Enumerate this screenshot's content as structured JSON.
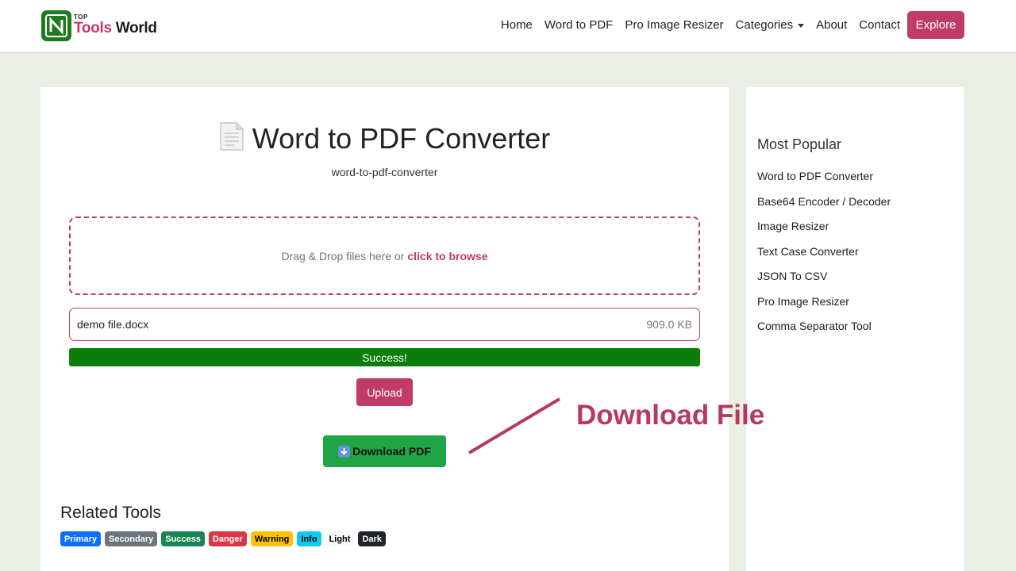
{
  "nav": {
    "logo": {
      "top_word": "TOP",
      "name_part1": "Tools",
      "name_part2": " World"
    },
    "links": [
      "Home",
      "Word to PDF",
      "Pro Image Resizer",
      "Categories",
      "About",
      "Contact"
    ],
    "explore_label": "Explore"
  },
  "main": {
    "title": "Word to PDF Converter",
    "title_icon": "document-icon",
    "subtitle": "word-to-pdf-converter",
    "dropzone": {
      "text": "Drag & Drop files here or",
      "browse": "click to browse"
    },
    "file": {
      "name": "demo file.docx",
      "size": "909.0 KB"
    },
    "progress": {
      "percent": 100,
      "label": "Success!"
    },
    "upload_label": "Upload",
    "download_label": "Download PDF",
    "download_icon": "down-arrow-icon",
    "related_title": "Related Tools",
    "badges": [
      {
        "label": "Primary",
        "bg": "#0d6efd",
        "fg": "#ffffff"
      },
      {
        "label": "Secondary",
        "bg": "#6c757d",
        "fg": "#ffffff"
      },
      {
        "label": "Success",
        "bg": "#198754",
        "fg": "#ffffff"
      },
      {
        "label": "Danger",
        "bg": "#dc3545",
        "fg": "#ffffff"
      },
      {
        "label": "Warning",
        "bg": "#ffc107",
        "fg": "#000000"
      },
      {
        "label": "Info",
        "bg": "#0dcaf0",
        "fg": "#000000"
      },
      {
        "label": "Light",
        "bg": "#f8f9fa",
        "fg": "#000000"
      },
      {
        "label": "Dark",
        "bg": "#212529",
        "fg": "#ffffff"
      }
    ]
  },
  "sidebar": {
    "title": "Most Popular",
    "items": [
      "Word to PDF Converter",
      "Base64 Encoder / Decoder",
      "Image Resizer",
      "Text Case Converter",
      "JSON To CSV",
      "Pro Image Resizer",
      "Comma Separator Tool"
    ]
  },
  "annotation": {
    "text": "Download File",
    "color": "#b8385f"
  },
  "colors": {
    "accent": "#c03b69",
    "success": "#0a7d0a",
    "download": "#20a545",
    "page_bg": "#e9efe5"
  }
}
